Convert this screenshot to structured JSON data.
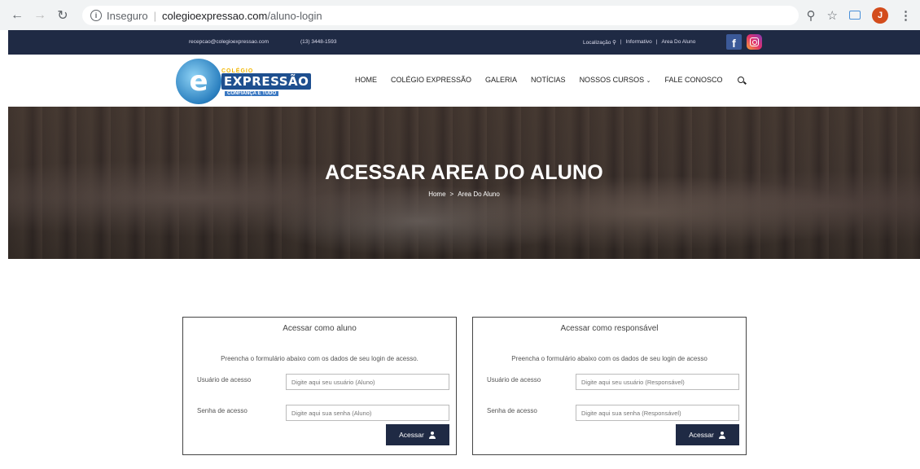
{
  "browser": {
    "secure_label": "Inseguro",
    "url_host": "colegioexpressao.com",
    "url_path": "/aluno-login",
    "profile_initial": "J"
  },
  "topbar": {
    "email": "recepcao@colegioexpressao.com",
    "phone": "(13) 3448-1593",
    "location": "Localização",
    "informativo": "Informativo",
    "area_aluno": "Area Do Aluno",
    "divider": "|"
  },
  "logo": {
    "letter": "e",
    "small": "COLÉGIO",
    "big": "EXPRESSÃO",
    "tagline": "CONFIANÇA E TUDO"
  },
  "menu": {
    "home": "HOME",
    "colegio": "COLÉGIO EXPRESSÃO",
    "galeria": "GALERIA",
    "noticias": "NOTÍCIAS",
    "cursos": "NOSSOS CURSOS",
    "fale": "FALE CONOSCO"
  },
  "hero": {
    "title": "ACESSAR AREA DO ALUNO",
    "crumb_home": "Home",
    "crumb_sep": ">",
    "crumb_current": "Area Do Aluno"
  },
  "aluno_form": {
    "title": "Acessar como aluno",
    "description": "Preencha o formulário abaixo com os dados de seu login de acesso.",
    "user_label": "Usuário de acesso",
    "user_placeholder": "Digite aqui seu usuário (Aluno)",
    "pass_label": "Senha de acesso",
    "pass_placeholder": "Digite aqui sua senha (Aluno)",
    "button": "Acessar"
  },
  "resp_form": {
    "title": "Acessar como responsável",
    "description": "Preencha o formulário abaixo com os dados de seu login de acesso",
    "user_label": "Usuário de acesso",
    "user_placeholder": "Digite aqui seu usuário (Responsável)",
    "pass_label": "Senha de acesso",
    "pass_placeholder": "Digite aqui sua senha (Responsável)",
    "button": "Acessar"
  },
  "colors": {
    "navy": "#1f2a44",
    "facebook": "#3b5998"
  }
}
